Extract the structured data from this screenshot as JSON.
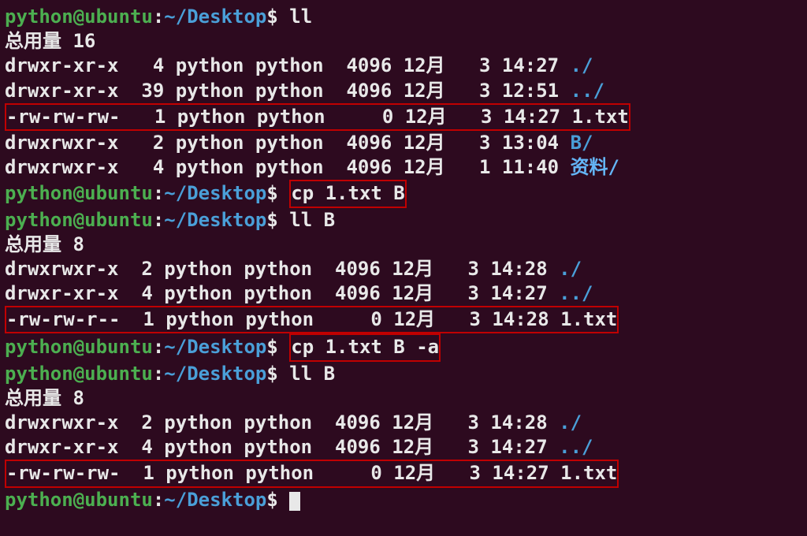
{
  "prompt": {
    "user": "python",
    "at": "@",
    "host": "ubuntu",
    "colon": ":",
    "tilde": "~",
    "slash": "/",
    "dir": "Desktop",
    "dollar": "$ "
  },
  "lines": [
    {
      "type": "prompt",
      "cmd": "ll"
    },
    {
      "type": "text",
      "text": "总用量 16"
    },
    {
      "type": "ls",
      "perms": "drwxr-xr-x",
      "links": "  4",
      "owner": "python",
      "group": "python",
      "size": " 4096",
      "month": "12月",
      "day": "  3",
      "time": "14:27",
      "name": "./",
      "color": "blue"
    },
    {
      "type": "ls",
      "perms": "drwxr-xr-x",
      "links": " 39",
      "owner": "python",
      "group": "python",
      "size": " 4096",
      "month": "12月",
      "day": "  3",
      "time": "12:51",
      "name": "../",
      "color": "blue"
    },
    {
      "type": "ls",
      "boxed": true,
      "perms": "-rw-rw-rw-",
      "links": "  1",
      "owner": "python",
      "group": "python",
      "size": "    0",
      "month": "12月",
      "day": "  3",
      "time": "14:27",
      "name": "1.txt",
      "color": "white"
    },
    {
      "type": "ls",
      "perms": "drwxrwxr-x",
      "links": "  2",
      "owner": "python",
      "group": "python",
      "size": " 4096",
      "month": "12月",
      "day": "  3",
      "time": "13:04",
      "name": "B/",
      "color": "blue"
    },
    {
      "type": "ls",
      "perms": "drwxrwxr-x",
      "links": "  4",
      "owner": "python",
      "group": "python",
      "size": " 4096",
      "month": "12月",
      "day": "  1",
      "time": "11:40",
      "name": "资料/",
      "color": "lightblue"
    },
    {
      "type": "prompt",
      "cmd_boxed": "cp 1.txt B"
    },
    {
      "type": "prompt",
      "cmd": "ll B"
    },
    {
      "type": "text",
      "text": "总用量 8"
    },
    {
      "type": "ls",
      "perms": "drwxrwxr-x",
      "links": " 2",
      "owner": "python",
      "group": "python",
      "size": " 4096",
      "month": "12月",
      "day": "  3",
      "time": "14:28",
      "name": "./",
      "color": "blue"
    },
    {
      "type": "ls",
      "perms": "drwxr-xr-x",
      "links": " 4",
      "owner": "python",
      "group": "python",
      "size": " 4096",
      "month": "12月",
      "day": "  3",
      "time": "14:27",
      "name": "../",
      "color": "blue"
    },
    {
      "type": "ls",
      "boxed": true,
      "perms": "-rw-rw-r--",
      "links": " 1",
      "owner": "python",
      "group": "python",
      "size": "    0",
      "month": "12月",
      "day": "  3",
      "time": "14:28",
      "name": "1.txt",
      "color": "white"
    },
    {
      "type": "prompt",
      "cmd_boxed": "cp 1.txt B -a"
    },
    {
      "type": "prompt",
      "cmd": "ll B"
    },
    {
      "type": "text",
      "text": "总用量 8"
    },
    {
      "type": "ls",
      "perms": "drwxrwxr-x",
      "links": " 2",
      "owner": "python",
      "group": "python",
      "size": " 4096",
      "month": "12月",
      "day": "  3",
      "time": "14:28",
      "name": "./",
      "color": "blue"
    },
    {
      "type": "ls",
      "perms": "drwxr-xr-x",
      "links": " 4",
      "owner": "python",
      "group": "python",
      "size": " 4096",
      "month": "12月",
      "day": "  3",
      "time": "14:27",
      "name": "../",
      "color": "blue"
    },
    {
      "type": "ls",
      "boxed": true,
      "perms": "-rw-rw-rw-",
      "links": " 1",
      "owner": "python",
      "group": "python",
      "size": "    0",
      "month": "12月",
      "day": "  3",
      "time": "14:27",
      "name": "1.txt",
      "color": "white"
    },
    {
      "type": "prompt",
      "cursor": true
    }
  ]
}
